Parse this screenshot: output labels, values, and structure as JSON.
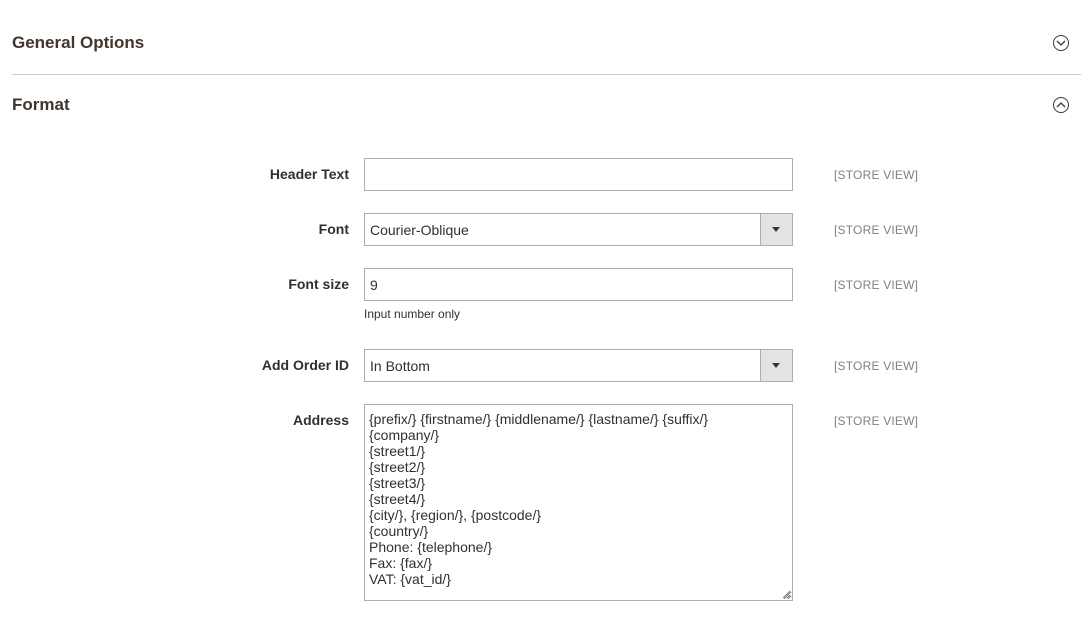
{
  "sections": {
    "general": {
      "title": "General Options",
      "expanded": false
    },
    "format": {
      "title": "Format",
      "expanded": true
    }
  },
  "form": {
    "header_text": {
      "label": "Header Text",
      "value": "",
      "scope": "[STORE VIEW]"
    },
    "font": {
      "label": "Font",
      "value": "Courier-Oblique",
      "scope": "[STORE VIEW]"
    },
    "font_size": {
      "label": "Font size",
      "value": "9",
      "note": "Input number only",
      "scope": "[STORE VIEW]"
    },
    "order_id": {
      "label": "Add Order ID",
      "value": "In Bottom",
      "scope": "[STORE VIEW]"
    },
    "address": {
      "label": "Address",
      "value": "{prefix/} {firstname/} {middlename/} {lastname/} {suffix/}\n{company/}\n{street1/}\n{street2/}\n{street3/}\n{street4/}\n{city/}, {region/}, {postcode/}\n{country/}\nPhone: {telephone/}\nFax: {fax/}\nVAT: {vat_id/}",
      "scope": "[STORE VIEW]"
    }
  },
  "icons": {
    "collapsed_toggle": "chevron-down-circle-icon",
    "expanded_toggle": "chevron-up-circle-icon",
    "select_arrow": "caret-down-icon"
  },
  "colors": {
    "heading": "#41362f",
    "border": "#adadad",
    "scope_text": "#808080",
    "arrow_bg": "#e3e3e3"
  }
}
